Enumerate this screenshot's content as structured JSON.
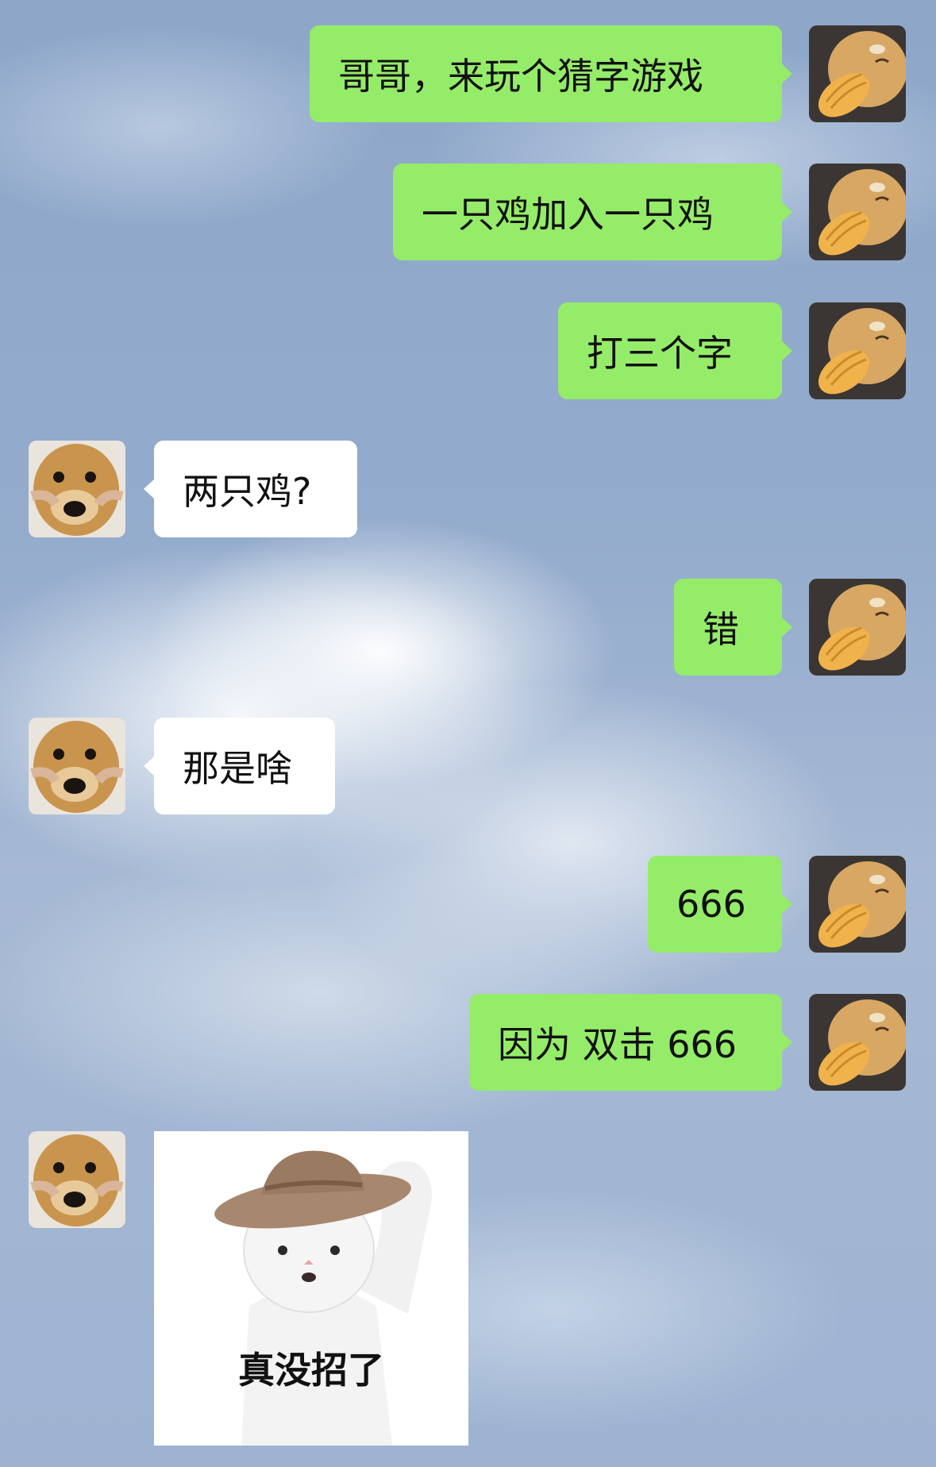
{
  "messages": [
    {
      "side": "out",
      "text": "哥哥，来玩个猜字游戏"
    },
    {
      "side": "out",
      "text": "一只鸡加入一只鸡"
    },
    {
      "side": "out",
      "text": "打三个字"
    },
    {
      "side": "in",
      "text": "两只鸡?"
    },
    {
      "side": "out",
      "text": "错"
    },
    {
      "side": "in",
      "text": "那是啥"
    },
    {
      "side": "out",
      "text": "666"
    },
    {
      "side": "out",
      "text": "因为 双击 666"
    },
    {
      "side": "in",
      "sticker_caption": "真没招了"
    }
  ],
  "avatars": {
    "self": "cat-with-bread-avatar",
    "other": "dog-face-avatar"
  },
  "colors": {
    "outgoing_bubble": "#95ec69",
    "incoming_bubble": "#ffffff"
  }
}
